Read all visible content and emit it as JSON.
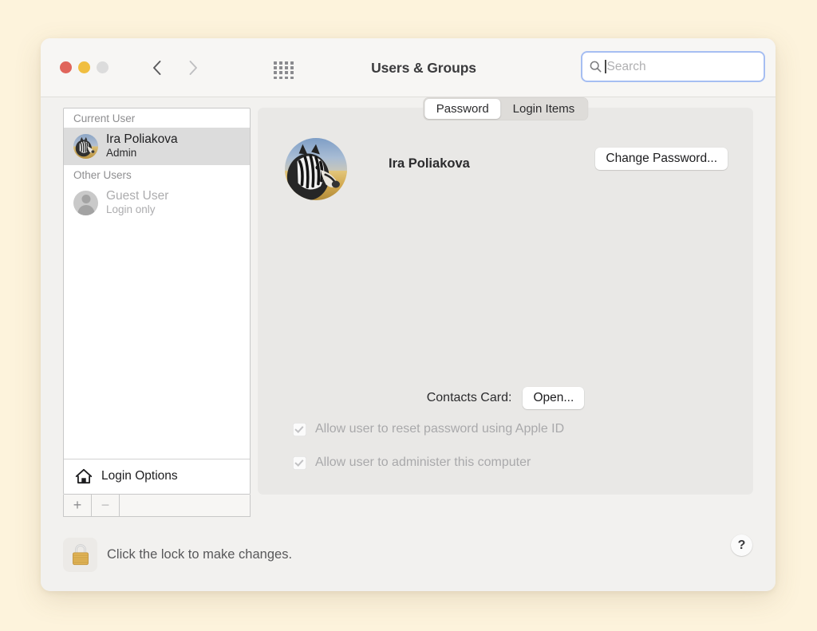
{
  "window": {
    "title": "Users & Groups"
  },
  "toolbar": {
    "traffic_lights": [
      {
        "name": "close",
        "color": "#e0655b"
      },
      {
        "name": "minimize",
        "color": "#f0be40"
      },
      {
        "name": "zoom",
        "color": "#dcdcdc"
      }
    ],
    "back_icon": "chevron-left-icon",
    "forward_icon": "chevron-right-icon",
    "grid_icon": "show-all-grid-icon",
    "search": {
      "icon": "search-icon",
      "value": "",
      "placeholder": "Search",
      "focused": true,
      "focus_ring_color": "#a6bef2"
    }
  },
  "sidebar": {
    "groups": [
      {
        "header": "Current User",
        "items": [
          {
            "name": "Ira Poliakova",
            "subtitle": "Admin",
            "selected": true,
            "avatar": "zebra-photo-avatar"
          }
        ]
      },
      {
        "header": "Other Users",
        "items": [
          {
            "name": "Guest User",
            "subtitle": "Login only",
            "selected": false,
            "disabled": true,
            "avatar": "generic-person-avatar"
          }
        ]
      }
    ],
    "login_options": {
      "label": "Login Options",
      "icon": "home-icon"
    },
    "add_button": "+",
    "remove_button": "−"
  },
  "main": {
    "tabs": [
      {
        "label": "Password",
        "active": true
      },
      {
        "label": "Login Items",
        "active": false
      }
    ],
    "profile": {
      "avatar": "zebra-photo-avatar",
      "name": "Ira Poliakova"
    },
    "change_password_label": "Change Password...",
    "contacts_card": {
      "label": "Contacts Card:",
      "button_label": "Open..."
    },
    "checkboxes": [
      {
        "label": "Allow user to reset password using Apple ID",
        "checked": true,
        "disabled": true
      },
      {
        "label": "Allow user to administer this computer",
        "checked": true,
        "disabled": true
      }
    ]
  },
  "bottom": {
    "lock_icon": "locked-padlock-icon",
    "lock_text": "Click the lock to make changes.",
    "help_label": "?"
  },
  "colors": {
    "page_background": "#fdf3dc",
    "window_background": "#f2f1ef",
    "toolbar_background": "#f7f6f4",
    "panel_background": "#e9e8e6",
    "selection": "#dcdcdc",
    "focus_ring": "#a6bef2"
  }
}
